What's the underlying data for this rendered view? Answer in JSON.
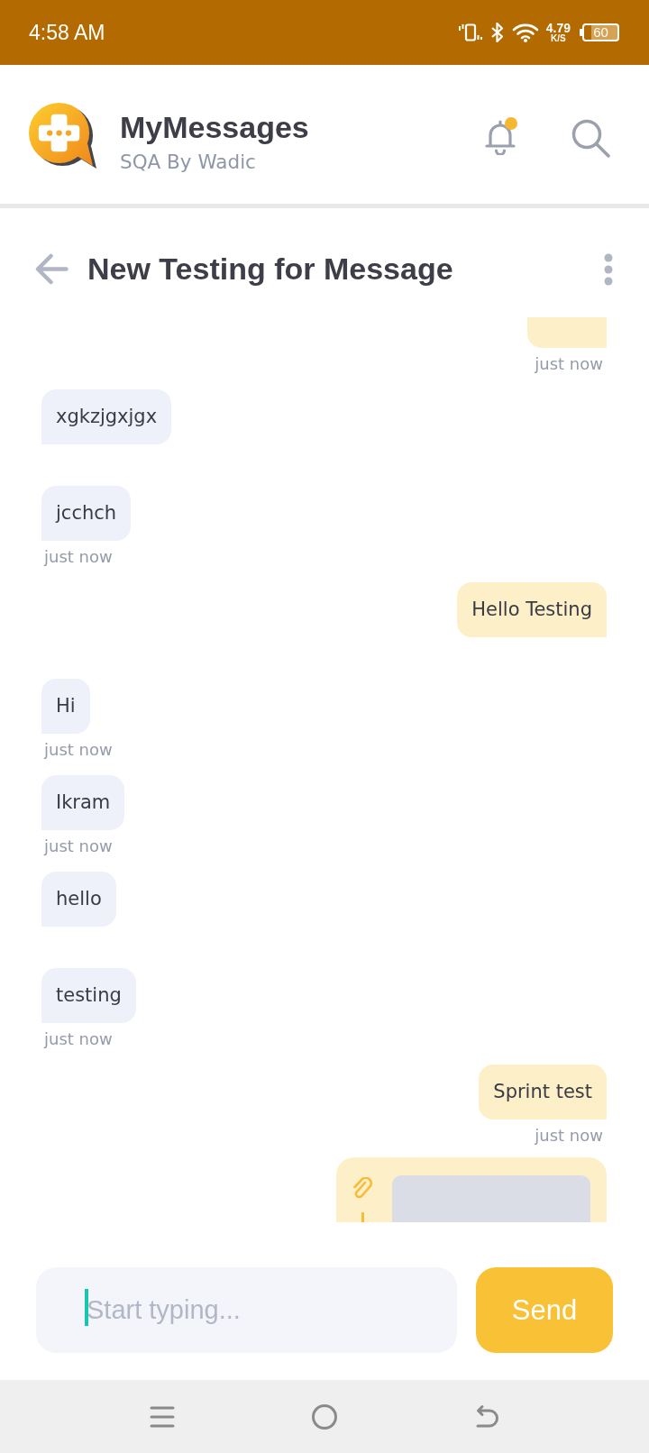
{
  "status_bar": {
    "time": "4:58 AM",
    "network_speed": "4.79",
    "speed_unit": "K/S",
    "battery": "60"
  },
  "app_bar": {
    "title": "MyMessages",
    "subtitle": "SQA By Wadic",
    "unread_notifications": true
  },
  "conversation": {
    "title": "New Testing for Message"
  },
  "messages": [
    {
      "kind": "clipped",
      "outgoing": true,
      "time": "just now"
    },
    {
      "kind": "text",
      "outgoing": false,
      "text": "xgkzjgxjgx"
    },
    {
      "kind": "text",
      "outgoing": false,
      "text": "jcchch",
      "time": "just now"
    },
    {
      "kind": "text",
      "outgoing": true,
      "text": "Hello Testing"
    },
    {
      "kind": "text",
      "outgoing": false,
      "text": "Hi",
      "time": "just now"
    },
    {
      "kind": "text",
      "outgoing": false,
      "text": "Ikram",
      "time": "just now"
    },
    {
      "kind": "text",
      "outgoing": false,
      "text": "hello"
    },
    {
      "kind": "text",
      "outgoing": false,
      "text": "testing",
      "time": "just now"
    },
    {
      "kind": "text",
      "outgoing": true,
      "text": "Sprint test",
      "time": "just now"
    },
    {
      "kind": "attachment",
      "outgoing": true
    }
  ],
  "composer": {
    "placeholder": "Start typing...",
    "focused": true,
    "send_button": "Send"
  }
}
